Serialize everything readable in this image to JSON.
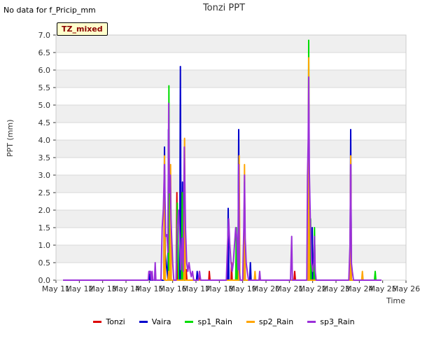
{
  "nodata_note": "No data for f_Pricip_mm",
  "annotation_box": "TZ_mixed",
  "chart_data": {
    "type": "line",
    "title": "Tonzi PPT",
    "xlabel": "Time",
    "ylabel": "PPT (mm)",
    "ylim": [
      0,
      7
    ],
    "yticks": [
      0.0,
      0.5,
      1.0,
      1.5,
      2.0,
      2.5,
      3.0,
      3.5,
      4.0,
      4.5,
      5.0,
      5.5,
      6.0,
      6.5,
      7.0
    ],
    "ytick_labels": [
      "0.0",
      "0.5",
      "1.0",
      "1.5",
      "2.0",
      "2.5",
      "3.0",
      "3.5",
      "4.0",
      "4.5",
      "5.0",
      "5.5",
      "6.0",
      "6.5",
      "7.0"
    ],
    "xlim_days": [
      11,
      26
    ],
    "xticks": [
      11,
      12,
      13,
      14,
      15,
      16,
      17,
      18,
      19,
      20,
      21,
      22,
      23,
      24,
      25,
      26
    ],
    "xtick_labels": [
      "May 11",
      "May 12",
      "May 13",
      "May 14",
      "May 15",
      "May 16",
      "May 17",
      "May 18",
      "May 19",
      "May 20",
      "May 21",
      "May 22",
      "May 23",
      "May 24",
      "May 25",
      "May 26"
    ],
    "grid": true,
    "legend_position": "bottom",
    "series": [
      {
        "name": "Tonzi",
        "color": "#dd0000",
        "points": [
          [
            16.15,
            0
          ],
          [
            16.18,
            2.5
          ],
          [
            16.21,
            0
          ],
          [
            16.35,
            0
          ],
          [
            16.38,
            2.5
          ],
          [
            16.41,
            0
          ],
          [
            16.55,
            0
          ],
          [
            16.58,
            0.3
          ],
          [
            16.61,
            0
          ],
          [
            17.12,
            0
          ],
          [
            17.15,
            0.25
          ],
          [
            17.18,
            0
          ],
          [
            17.55,
            0
          ],
          [
            17.57,
            0.25
          ],
          [
            17.6,
            0
          ],
          [
            18.5,
            0
          ],
          [
            18.52,
            0.5
          ],
          [
            18.55,
            0
          ],
          [
            18.7,
            0
          ],
          [
            18.72,
            0.25
          ],
          [
            18.75,
            0
          ],
          [
            21.2,
            0
          ],
          [
            21.23,
            0.25
          ],
          [
            21.26,
            0
          ]
        ]
      },
      {
        "name": "Vaira",
        "color": "#0000cc",
        "points": [
          [
            15.0,
            0
          ],
          [
            15.02,
            0.25
          ],
          [
            15.05,
            0
          ],
          [
            15.62,
            0
          ],
          [
            15.65,
            3.8
          ],
          [
            15.68,
            0.75
          ],
          [
            15.8,
            0
          ],
          [
            15.82,
            4.3
          ],
          [
            15.85,
            0
          ],
          [
            16.3,
            0
          ],
          [
            16.33,
            6.1
          ],
          [
            16.36,
            0
          ],
          [
            16.4,
            0
          ],
          [
            16.42,
            2.8
          ],
          [
            16.45,
            0
          ],
          [
            17.02,
            0
          ],
          [
            17.05,
            0.25
          ],
          [
            17.08,
            0
          ],
          [
            18.35,
            0
          ],
          [
            18.38,
            2.05
          ],
          [
            18.41,
            0
          ],
          [
            18.8,
            0
          ],
          [
            18.83,
            4.3
          ],
          [
            18.86,
            0
          ],
          [
            19.05,
            0
          ],
          [
            19.08,
            2.8
          ],
          [
            19.11,
            0
          ],
          [
            19.3,
            0
          ],
          [
            19.33,
            0.5
          ],
          [
            19.36,
            0
          ],
          [
            21.95,
            0
          ],
          [
            21.98,
            1.5
          ],
          [
            22.01,
            0
          ],
          [
            23.6,
            0
          ],
          [
            23.63,
            4.3
          ],
          [
            23.66,
            0
          ]
        ]
      },
      {
        "name": "sp1_Rain",
        "color": "#00dd00",
        "points": [
          [
            15.82,
            0
          ],
          [
            15.84,
            5.55
          ],
          [
            15.87,
            0
          ],
          [
            16.15,
            0
          ],
          [
            16.2,
            2.2
          ],
          [
            16.25,
            0
          ],
          [
            16.38,
            0
          ],
          [
            16.41,
            2.5
          ],
          [
            16.44,
            0
          ],
          [
            18.7,
            0
          ],
          [
            18.73,
            1.5
          ],
          [
            18.76,
            0
          ],
          [
            21.8,
            0
          ],
          [
            21.83,
            6.85
          ],
          [
            21.86,
            0
          ],
          [
            21.88,
            0
          ],
          [
            21.91,
            1.75
          ],
          [
            21.94,
            0
          ],
          [
            22.05,
            0
          ],
          [
            22.08,
            1.5
          ],
          [
            22.11,
            0
          ],
          [
            24.65,
            0
          ],
          [
            24.68,
            0.25
          ],
          [
            24.71,
            0
          ]
        ]
      },
      {
        "name": "sp2_Rain",
        "color": "#ffa500",
        "points": [
          [
            15.62,
            0
          ],
          [
            15.65,
            3.55
          ],
          [
            15.68,
            0
          ],
          [
            15.8,
            0
          ],
          [
            15.83,
            0.25
          ],
          [
            15.86,
            0
          ],
          [
            15.88,
            0
          ],
          [
            15.91,
            3.3
          ],
          [
            15.94,
            0
          ],
          [
            16.48,
            0
          ],
          [
            16.51,
            4.05
          ],
          [
            16.54,
            0
          ],
          [
            18.82,
            0
          ],
          [
            18.85,
            3.55
          ],
          [
            18.88,
            0
          ],
          [
            19.05,
            0
          ],
          [
            19.08,
            3.3
          ],
          [
            19.11,
            0
          ],
          [
            19.5,
            0
          ],
          [
            19.53,
            0.25
          ],
          [
            19.56,
            0
          ],
          [
            21.8,
            0
          ],
          [
            21.83,
            6.35
          ],
          [
            21.86,
            0
          ],
          [
            23.6,
            0
          ],
          [
            23.63,
            3.55
          ],
          [
            23.66,
            0
          ],
          [
            24.1,
            0
          ],
          [
            24.13,
            0.25
          ],
          [
            24.16,
            0
          ]
        ]
      },
      {
        "name": "sp3_Rain",
        "color": "#9b30d9",
        "points": [
          [
            11.3,
            0
          ],
          [
            14.95,
            0
          ],
          [
            14.98,
            0.25
          ],
          [
            15.0,
            0.2
          ],
          [
            15.05,
            0.25
          ],
          [
            15.08,
            0
          ],
          [
            15.12,
            0.25
          ],
          [
            15.15,
            0
          ],
          [
            15.22,
            0
          ],
          [
            15.25,
            0.5
          ],
          [
            15.28,
            0
          ],
          [
            15.5,
            0
          ],
          [
            15.55,
            1.5
          ],
          [
            15.6,
            2.0
          ],
          [
            15.65,
            3.3
          ],
          [
            15.7,
            1.25
          ],
          [
            15.75,
            1.3
          ],
          [
            15.8,
            0.8
          ],
          [
            15.83,
            5.05
          ],
          [
            15.86,
            2.5
          ],
          [
            15.9,
            3.0
          ],
          [
            15.93,
            1.75
          ],
          [
            15.97,
            1.0
          ],
          [
            16.0,
            0.5
          ],
          [
            16.05,
            0
          ],
          [
            16.15,
            0
          ],
          [
            16.2,
            1.5
          ],
          [
            16.25,
            2.0
          ],
          [
            16.3,
            1.2
          ],
          [
            16.35,
            0.3
          ],
          [
            16.4,
            1.2
          ],
          [
            16.45,
            0.25
          ],
          [
            16.5,
            3.8
          ],
          [
            16.55,
            1.5
          ],
          [
            16.6,
            0.5
          ],
          [
            16.65,
            0.25
          ],
          [
            16.7,
            0.5
          ],
          [
            16.75,
            0.25
          ],
          [
            16.8,
            0.1
          ],
          [
            16.85,
            0.25
          ],
          [
            16.9,
            0
          ],
          [
            17.1,
            0
          ],
          [
            17.15,
            0.25
          ],
          [
            17.2,
            0
          ],
          [
            18.3,
            0
          ],
          [
            18.35,
            1.0
          ],
          [
            18.4,
            1.75
          ],
          [
            18.45,
            1.0
          ],
          [
            18.5,
            0.5
          ],
          [
            18.55,
            0.25
          ],
          [
            18.6,
            0.5
          ],
          [
            18.65,
            1.0
          ],
          [
            18.7,
            1.5
          ],
          [
            18.75,
            1.2
          ],
          [
            18.8,
            0.3
          ],
          [
            18.83,
            3.3
          ],
          [
            18.86,
            0.25
          ],
          [
            18.9,
            0
          ],
          [
            19.0,
            0
          ],
          [
            19.05,
            1.5
          ],
          [
            19.08,
            3.0
          ],
          [
            19.11,
            1.2
          ],
          [
            19.15,
            0.5
          ],
          [
            19.2,
            0.25
          ],
          [
            19.25,
            0
          ],
          [
            19.7,
            0
          ],
          [
            19.73,
            0.25
          ],
          [
            19.76,
            0
          ],
          [
            21.05,
            0
          ],
          [
            21.1,
            1.25
          ],
          [
            21.13,
            0
          ],
          [
            21.75,
            0
          ],
          [
            21.78,
            3.0
          ],
          [
            21.81,
            4.0
          ],
          [
            21.83,
            5.8
          ],
          [
            21.86,
            3.0
          ],
          [
            21.9,
            1.75
          ],
          [
            21.95,
            0.5
          ],
          [
            22.0,
            0.25
          ],
          [
            22.05,
            0.5
          ],
          [
            22.08,
            1.25
          ],
          [
            22.11,
            0.25
          ],
          [
            22.15,
            0
          ],
          [
            23.55,
            0
          ],
          [
            23.6,
            1.0
          ],
          [
            23.63,
            3.3
          ],
          [
            23.66,
            0.5
          ],
          [
            23.7,
            0.25
          ],
          [
            23.75,
            0
          ],
          [
            24.95,
            0
          ]
        ]
      }
    ]
  }
}
